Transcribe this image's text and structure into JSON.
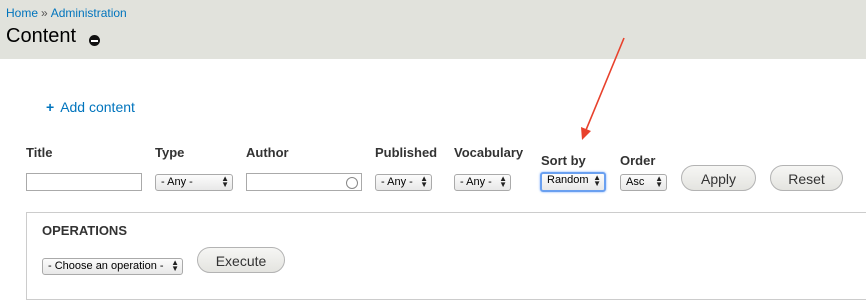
{
  "breadcrumb": {
    "home": "Home",
    "separator": "»",
    "admin": "Administration"
  },
  "page": {
    "title": "Content"
  },
  "actions": {
    "add_content_icon": "+",
    "add_content": "Add content"
  },
  "filters": {
    "title_label": "Title",
    "title_value": "",
    "type_label": "Type",
    "type_value": "- Any -",
    "author_label": "Author",
    "author_value": "",
    "published_label": "Published",
    "published_value": "- Any -",
    "vocabulary_label": "Vocabulary",
    "vocabulary_value": "- Any -",
    "sort_label": "Sort by",
    "sort_value": "Random",
    "order_label": "Order",
    "order_value": "Asc",
    "apply": "Apply",
    "reset": "Reset"
  },
  "operations": {
    "title": "OPERATIONS",
    "select_value": "- Choose an operation -",
    "execute": "Execute"
  },
  "colors": {
    "header_bg": "#e1e2dc",
    "link": "#0074bd",
    "annotation_arrow": "#e8412c",
    "focus": "#6aa0f0"
  }
}
